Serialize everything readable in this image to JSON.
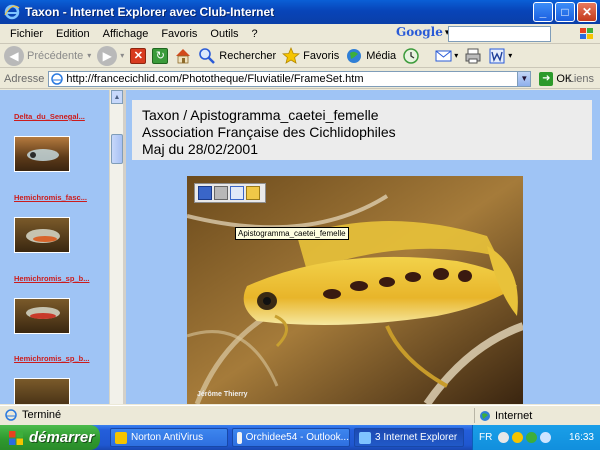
{
  "window": {
    "title": "Taxon - Internet Explorer avec Club-Internet",
    "minimize": "_",
    "maximize": "□",
    "close": "✕"
  },
  "menu": [
    "Fichier",
    "Edition",
    "Affichage",
    "Favoris",
    "Outils",
    "?"
  ],
  "google": {
    "label": "Google",
    "dropdown": "▾"
  },
  "toolbar": {
    "back": "Précédente",
    "search": "Rechercher",
    "favorites": "Favoris",
    "media": "Média"
  },
  "address": {
    "label": "Adresse",
    "url": "http://francecichlid.com/Phototheque/Fluviatile/FrameSet.htm",
    "go": "OK",
    "links": "Liens"
  },
  "left_frame": {
    "items": [
      {
        "label": "Delta_du_Senegal..."
      },
      {
        "label": "Hemichromis_fasc..."
      },
      {
        "label": "Hemichromis_sp_b..."
      },
      {
        "label": "Hemichromis_sp_b..."
      }
    ]
  },
  "header": {
    "line1": "Taxon / Apistogramma_caetei_femelle",
    "line2": "Association Française des Cichlidophiles",
    "line3": "Maj du 28/02/2001"
  },
  "photo": {
    "tooltip": "Apistogramma_caetei_femelle",
    "credit": "Jérôme Thierry"
  },
  "status": {
    "text": "Terminé",
    "zone": "Internet"
  },
  "taskbar": {
    "start": "démarrer",
    "tasks": [
      "Norton AntiVirus",
      "Orchidee54 - Outlook...",
      "3 Internet Explorer"
    ],
    "lang": "FR",
    "clock": "16:33"
  },
  "colors": {
    "xp_blue": "#0a5fd6",
    "frame_bg": "#9fc4f5",
    "link_red": "#cc1c1c",
    "start_green": "#3aa83a"
  }
}
